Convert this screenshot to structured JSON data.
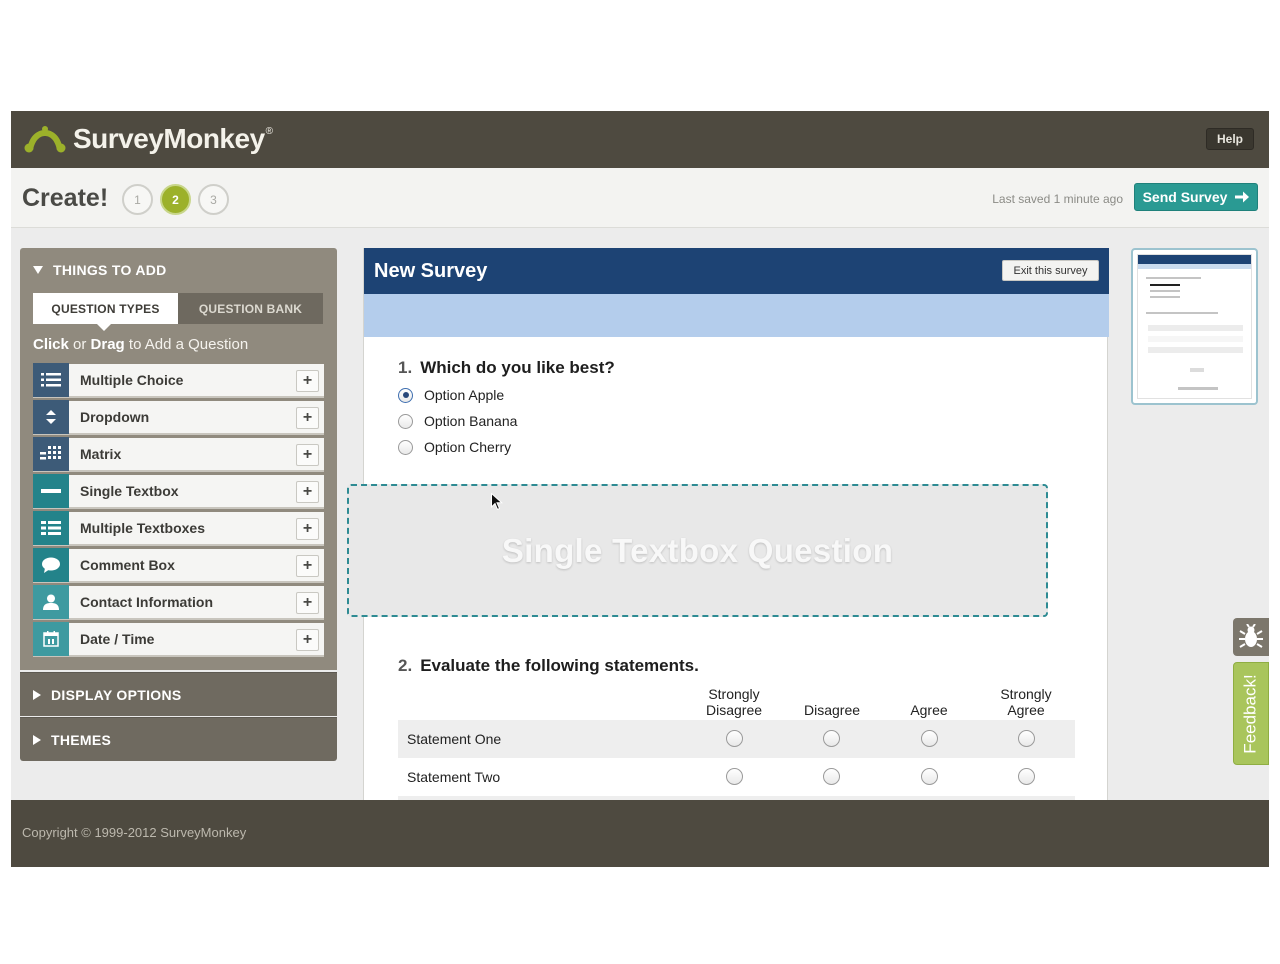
{
  "header": {
    "logo_text": "SurveyMonkey",
    "logo_mark": "®",
    "help_label": "Help"
  },
  "createbar": {
    "title": "Create!",
    "steps": [
      "1",
      "2",
      "3"
    ],
    "active_step": "2",
    "last_saved": "Last saved 1 minute ago",
    "send_label": "Send Survey"
  },
  "sidebar": {
    "things_to_add": "THINGS TO ADD",
    "tabs": [
      "QUESTION TYPES",
      "QUESTION BANK"
    ],
    "hint_click": "Click",
    "hint_or": "or",
    "hint_drag": "Drag",
    "hint_rest": "to Add a Question",
    "items": [
      {
        "label": "Multiple Choice",
        "icon": "list-icon",
        "color": "#3d5b78"
      },
      {
        "label": "Dropdown",
        "icon": "dropdown-arrows-icon",
        "color": "#3d5b78"
      },
      {
        "label": "Matrix",
        "icon": "matrix-grid-icon",
        "color": "#3d5b78"
      },
      {
        "label": "Single Textbox",
        "icon": "single-textbox-icon",
        "color": "#23838a"
      },
      {
        "label": "Multiple Textboxes",
        "icon": "multiple-textboxes-icon",
        "color": "#23838a"
      },
      {
        "label": "Comment Box",
        "icon": "speech-bubble-icon",
        "color": "#23838a"
      },
      {
        "label": "Contact Information",
        "icon": "person-icon",
        "color": "#3e9aa0"
      },
      {
        "label": "Date / Time",
        "icon": "calendar-icon",
        "color": "#3e9aa0"
      }
    ],
    "add_label": "+",
    "display_options": "DISPLAY OPTIONS",
    "themes": "THEMES"
  },
  "survey": {
    "title": "New Survey",
    "exit_label": "Exit this survey",
    "q1": {
      "number": "1.",
      "title": "Which do you like best?",
      "options": [
        "Option Apple",
        "Option Banana",
        "Option Cherry"
      ],
      "selected_index": 0
    },
    "drop_zone": "Single Textbox Question",
    "q2": {
      "number": "2.",
      "title": "Evaluate the following statements.",
      "columns": [
        {
          "line1": "Strongly",
          "line2": "Disagree"
        },
        {
          "line1": "",
          "line2": "Disagree"
        },
        {
          "line1": "",
          "line2": "Agree"
        },
        {
          "line1": "Strongly",
          "line2": "Agree"
        }
      ],
      "rows": [
        "Statement One",
        "Statement Two"
      ]
    }
  },
  "feedback": {
    "label": "Feedback!"
  },
  "footer": {
    "copyright": "Copyright © 1999-2012 SurveyMonkey"
  }
}
